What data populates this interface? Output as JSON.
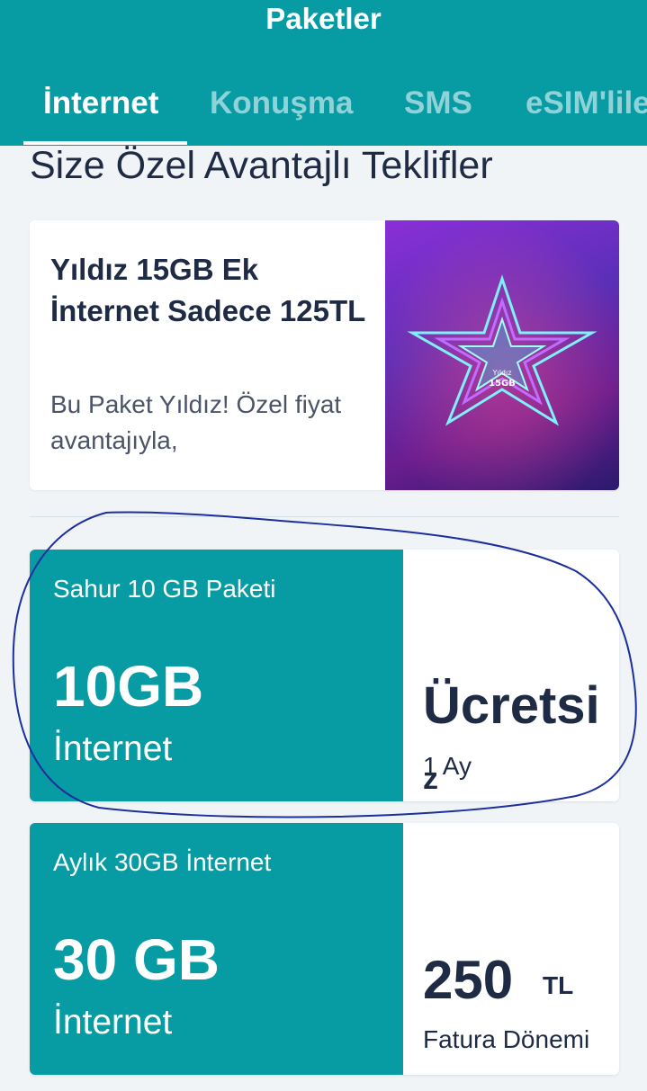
{
  "header": {
    "title": "Paketler"
  },
  "tabs": [
    {
      "label": "İnternet"
    },
    {
      "label": "Konuşma"
    },
    {
      "label": "SMS"
    },
    {
      "label": "eSIM'lile"
    }
  ],
  "section_title": "Size Özel Avantajlı Teklifler",
  "offer": {
    "title": "Yıldız 15GB Ek İnternet Sadece 125TL",
    "description": "Bu Paket Yıldız! Özel fiyat avantajıyla,",
    "image_label_line1": "Yıldız",
    "image_label_line2": "15GB"
  },
  "packages": [
    {
      "name": "Sahur 10 GB Paketi",
      "amount": "10GB",
      "type": "İnternet",
      "price": "Ücretsi",
      "price_overflow": "z",
      "period": "1 Ay"
    },
    {
      "name": "Aylık 30GB İnternet",
      "amount": "30 GB",
      "type": "İnternet",
      "price": "250",
      "currency": "TL",
      "period": "Fatura Dönemi"
    }
  ],
  "colors": {
    "brand": "#079ba4",
    "text_dark": "#1f2a44",
    "annotation": "#1c2f9e"
  }
}
